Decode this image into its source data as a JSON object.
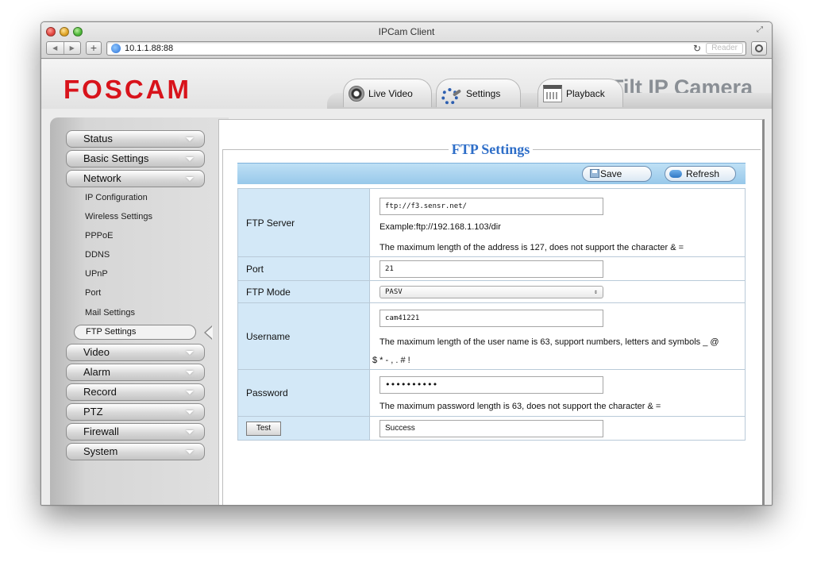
{
  "window": {
    "title": "IPCam Client",
    "url": "10.1.1.88:88",
    "reader_label": "Reader"
  },
  "banner": {
    "logo": "FOSCAM",
    "title": "Tilt IP Camera",
    "tabs": [
      {
        "label": "Live Video",
        "icon": "webcam-icon"
      },
      {
        "label": "Settings",
        "icon": "gear-icon"
      },
      {
        "label": "Playback",
        "icon": "calendar-icon"
      }
    ]
  },
  "sidebar": {
    "groups_top": [
      "Status",
      "Basic Settings",
      "Network"
    ],
    "network_items": [
      "IP Configuration",
      "Wireless Settings",
      "PPPoE",
      "DDNS",
      "UPnP",
      "Port",
      "Mail Settings"
    ],
    "active_item": "FTP Settings",
    "groups_bottom": [
      "Video",
      "Alarm",
      "Record",
      "PTZ",
      "Firewall",
      "System"
    ]
  },
  "ftp": {
    "heading": "FTP Settings",
    "save_label": "Save",
    "refresh_label": "Refresh",
    "server_label": "FTP Server",
    "server_value": "ftp://f3.sensr.net/",
    "server_example": "Example:ftp://192.168.1.103/dir",
    "server_note": "The maximum length of the address is 127,  does not support the character & =",
    "port_label": "Port",
    "port_value": "21",
    "mode_label": "FTP Mode",
    "mode_value": "PASV",
    "username_label": "Username",
    "username_value": "cam41221",
    "username_note_1": "The maximum length of the user name is 63, support numbers, letters and symbols _ @",
    "username_note_2": "$ * - , . # !",
    "password_label": "Password",
    "password_value": "••••••••••",
    "password_note": "The maximum password length is 63, does not support the character & =",
    "test_label": "Test",
    "test_result": "Success"
  }
}
